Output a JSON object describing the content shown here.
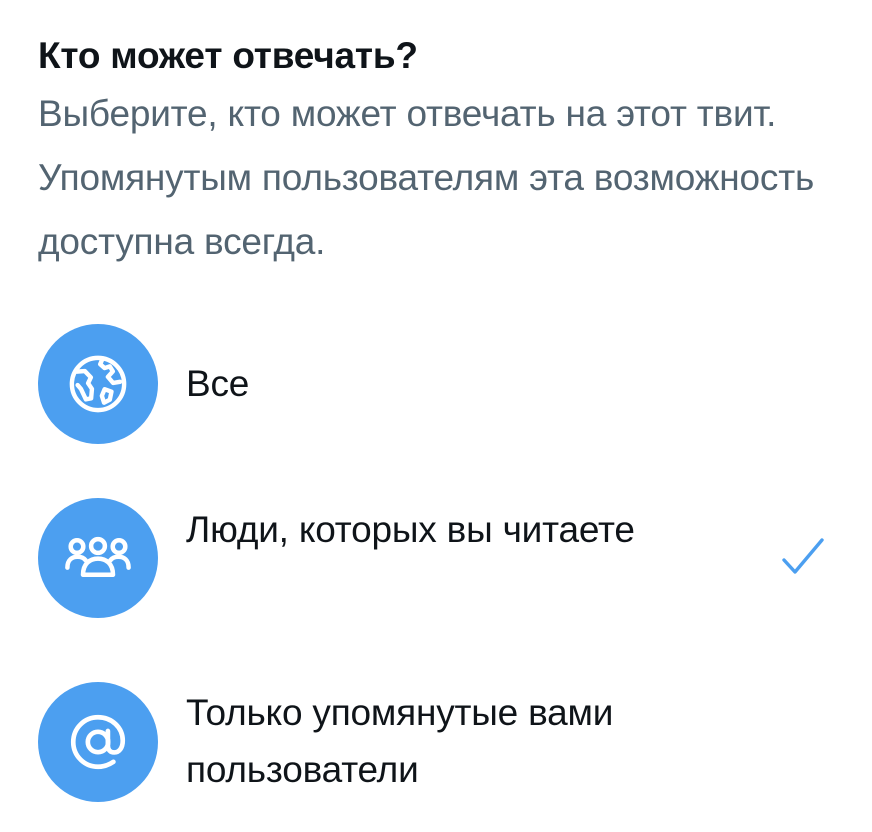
{
  "dialog": {
    "title": "Кто может отвечать?",
    "subtitle": "Выберите, кто может отвечать на этот твит. Упомянутым пользователям эта возможность доступна всегда."
  },
  "options": [
    {
      "label": "Все",
      "icon": "globe-icon",
      "selected": false
    },
    {
      "label": "Люди, которых вы читаете",
      "icon": "people-icon",
      "selected": true
    },
    {
      "label": "Только упомянутые вами пользователи",
      "icon": "at-sign-icon",
      "selected": false
    }
  ],
  "colors": {
    "accent": "#4c9ff0",
    "text_primary": "#0f1419",
    "text_secondary": "#536471",
    "check": "#4c9ff0"
  }
}
